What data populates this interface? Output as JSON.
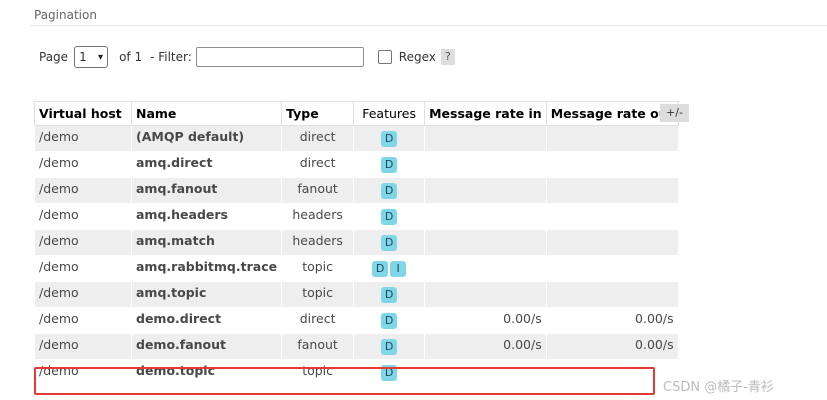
{
  "pagination": {
    "title": "Pagination",
    "page_label": "Page",
    "page_value": "1",
    "of_label": "of 1",
    "filter_label": "- Filter:",
    "filter_value": "",
    "regex_label": "Regex",
    "regex_checked": false,
    "help_label": "?"
  },
  "table": {
    "headers": [
      "Virtual host",
      "Name",
      "Type",
      "Features",
      "Message rate in",
      "Message rate out"
    ],
    "toggle_label": "+/-",
    "rows": [
      {
        "vhost": "/demo",
        "name": "(AMQP default)",
        "type": "direct",
        "features": [
          "D"
        ],
        "rate_in": "",
        "rate_out": ""
      },
      {
        "vhost": "/demo",
        "name": "amq.direct",
        "type": "direct",
        "features": [
          "D"
        ],
        "rate_in": "",
        "rate_out": ""
      },
      {
        "vhost": "/demo",
        "name": "amq.fanout",
        "type": "fanout",
        "features": [
          "D"
        ],
        "rate_in": "",
        "rate_out": ""
      },
      {
        "vhost": "/demo",
        "name": "amq.headers",
        "type": "headers",
        "features": [
          "D"
        ],
        "rate_in": "",
        "rate_out": ""
      },
      {
        "vhost": "/demo",
        "name": "amq.match",
        "type": "headers",
        "features": [
          "D"
        ],
        "rate_in": "",
        "rate_out": ""
      },
      {
        "vhost": "/demo",
        "name": "amq.rabbitmq.trace",
        "type": "topic",
        "features": [
          "D",
          "I"
        ],
        "rate_in": "",
        "rate_out": ""
      },
      {
        "vhost": "/demo",
        "name": "amq.topic",
        "type": "topic",
        "features": [
          "D"
        ],
        "rate_in": "",
        "rate_out": ""
      },
      {
        "vhost": "/demo",
        "name": "demo.direct",
        "type": "direct",
        "features": [
          "D"
        ],
        "rate_in": "0.00/s",
        "rate_out": "0.00/s"
      },
      {
        "vhost": "/demo",
        "name": "demo.fanout",
        "type": "fanout",
        "features": [
          "D"
        ],
        "rate_in": "0.00/s",
        "rate_out": "0.00/s"
      },
      {
        "vhost": "/demo",
        "name": "demo.topic",
        "type": "topic",
        "features": [
          "D"
        ],
        "rate_in": "",
        "rate_out": ""
      }
    ]
  },
  "colors": {
    "badge": "#7fd6e8",
    "highlight": "#e53935",
    "stripe": "#eeeeee"
  },
  "watermark": "CSDN @橘子-青衫"
}
